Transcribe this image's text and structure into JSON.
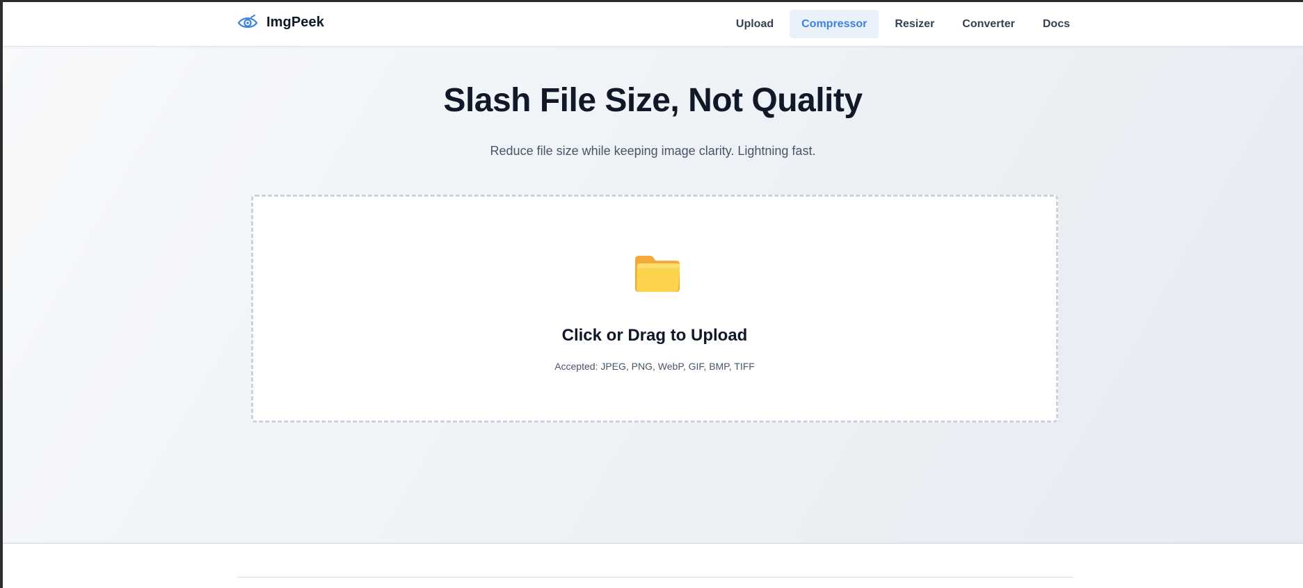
{
  "header": {
    "brand_name": "ImgPeek",
    "logo_icon": "eye-logo-icon",
    "nav": [
      {
        "label": "Upload",
        "active": false
      },
      {
        "label": "Compressor",
        "active": true
      },
      {
        "label": "Resizer",
        "active": false
      },
      {
        "label": "Converter",
        "active": false
      },
      {
        "label": "Docs",
        "active": false
      }
    ]
  },
  "hero": {
    "title": "Slash File Size, Not Quality",
    "subtitle": "Reduce file size while keeping image clarity. Lightning fast."
  },
  "dropzone": {
    "icon": "folder-icon",
    "title": "Click or Drag to Upload",
    "hint": "Accepted: JPEG, PNG, WebP, GIF, BMP, TIFF"
  },
  "colors": {
    "accent": "#3b82e0",
    "active_bg": "#eaf1fb",
    "text_dark": "#0f172a",
    "text_muted": "#475569",
    "folder": "#fcd34d"
  }
}
